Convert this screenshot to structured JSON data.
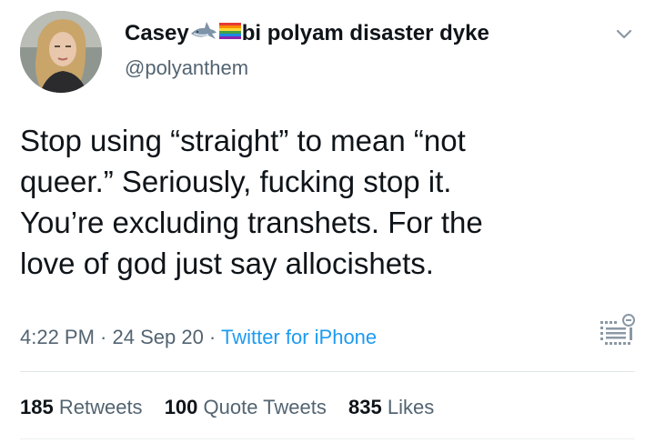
{
  "author": {
    "display_name": "Casey",
    "display_name_suffix": "bi polyam disaster dyke",
    "handle": "@polyanthem",
    "name_emojis": [
      "shark-icon",
      "rainbow-flag-icon"
    ]
  },
  "tweet": {
    "lines": [
      "Stop using “straight” to mean “not",
      "queer.” Seriously, fucking stop it.",
      "You’re excluding transhets. For the",
      "love of god just say allocishets."
    ]
  },
  "meta": {
    "time": "4:22 PM",
    "sep1": " · ",
    "date": "24 Sep 20",
    "sep2": " · ",
    "source": "Twitter for iPhone"
  },
  "stats": {
    "retweets_count": "185",
    "retweets_label": "Retweets",
    "quotes_count": "100",
    "quotes_label": "Quote Tweets",
    "likes_count": "835",
    "likes_label": "Likes"
  },
  "colors": {
    "text": "#0f1419",
    "secondary": "#536471",
    "link": "#1d9bf0",
    "divider": "#e3e6e8"
  }
}
